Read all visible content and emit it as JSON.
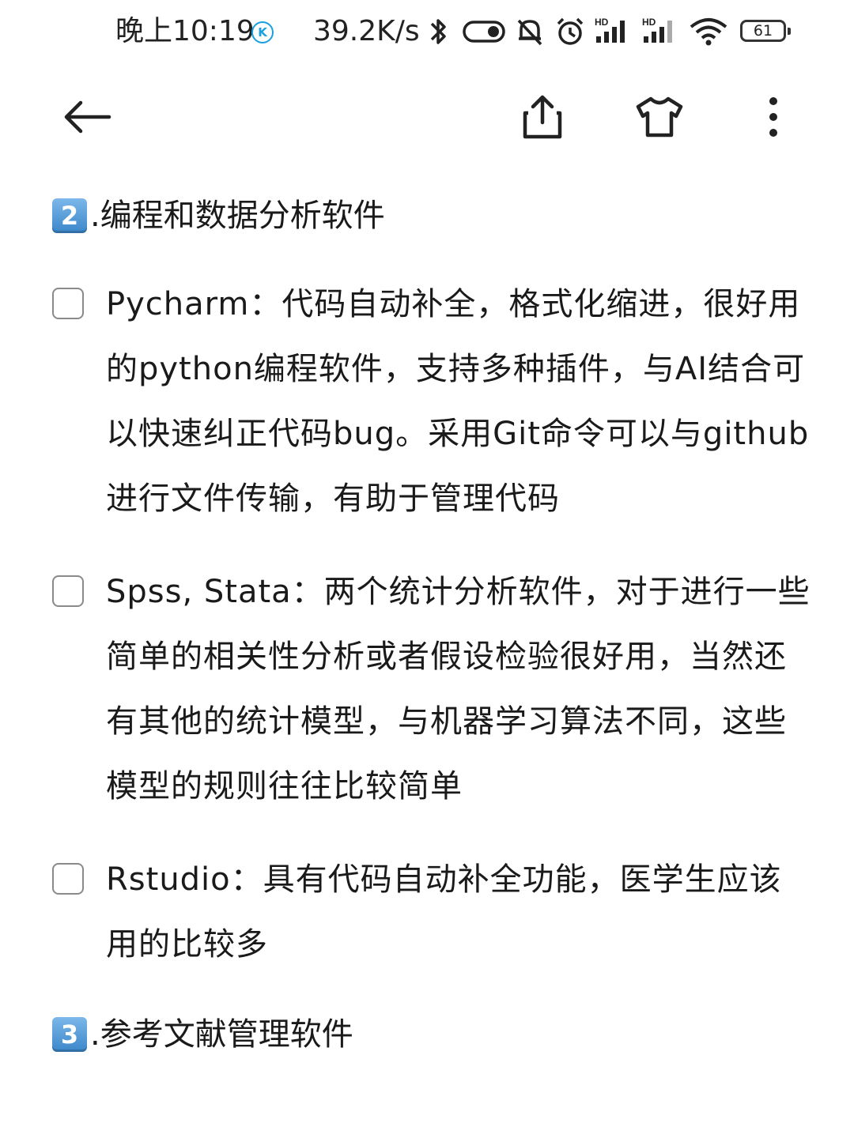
{
  "status_bar": {
    "time": "晚上10:19",
    "k_badge": "K",
    "net_speed": "39.2K/s",
    "signal_1_label": "HD",
    "signal_2_label": "HD",
    "battery": "61"
  },
  "sections": [
    {
      "number": "2",
      "title": ".编程和数据分析软件",
      "items": [
        {
          "checked": false,
          "text": "Pycharm：代码自动补全，格式化缩进，很好用的python编程软件，支持多种插件，与AI结合可以快速纠正代码bug。采用Git命令可以与github进行文件传输，有助于管理代码"
        },
        {
          "checked": false,
          "text": "Spss, Stata：两个统计分析软件，对于进行一些简单的相关性分析或者假设检验很好用，当然还有其他的统计模型，与机器学习算法不同，这些模型的规则往往比较简单"
        },
        {
          "checked": false,
          "text": "Rstudio：具有代码自动补全功能，医学生应该用的比较多"
        }
      ]
    },
    {
      "number": "3",
      "title": ".参考文献管理软件",
      "items": []
    }
  ]
}
